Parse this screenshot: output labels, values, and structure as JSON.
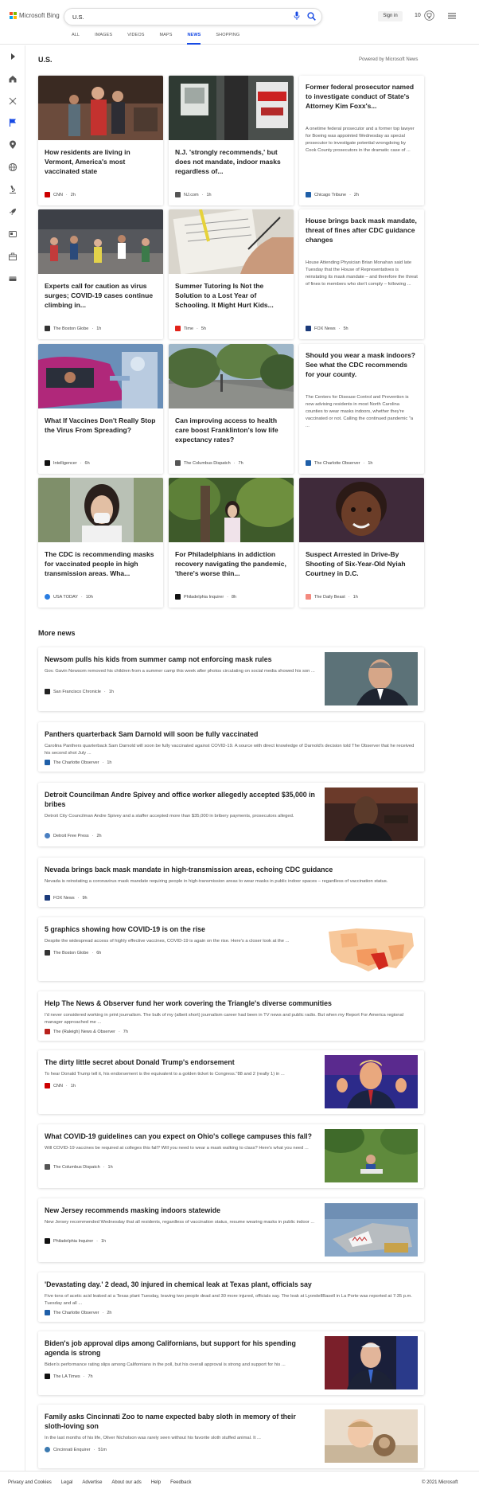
{
  "header": {
    "brand": "Microsoft Bing",
    "query": "U.S.",
    "signin_label": "Sign in",
    "rewards_count": "10",
    "tabs": [
      {
        "label": "ALL"
      },
      {
        "label": "IMAGES"
      },
      {
        "label": "VIDEOS"
      },
      {
        "label": "MAPS"
      },
      {
        "label": "NEWS"
      },
      {
        "label": "SHOPPING"
      }
    ],
    "active_tab": "NEWS"
  },
  "rail": {
    "icons": [
      "expand-icon",
      "home-icon",
      "sports-icon",
      "flag-icon",
      "location-icon",
      "globe-icon",
      "microscope-icon",
      "science-rocket-icon",
      "entertainment-icon",
      "business-icon",
      "money-icon"
    ]
  },
  "main": {
    "section_title": "U.S.",
    "powered_by": "Powered by Microsoft News",
    "cards": [
      {
        "title": "How residents are living in Vermont, America's most vaccinated state",
        "source": "CNN",
        "time": "2h"
      },
      {
        "title": "N.J. 'strongly recommends,' but does not mandate, indoor masks regardless of...",
        "source": "NJ.com",
        "time": "1h"
      },
      {
        "title": "Former federal prosecutor named to investigate conduct of State's Attorney Kim Foxx's...",
        "snippet": "A onetime federal prosecutor and a former top lawyer for Boeing was appointed Wednesday as special prosecutor to investigate potential wrongdoing by Cook County prosecutors in the dramatic case of ...",
        "source": "Chicago Tribune",
        "time": "2h"
      },
      {
        "title": "Experts call for caution as virus surges; COVID-19 cases continue climbing in...",
        "source": "The Boston Globe",
        "time": "1h"
      },
      {
        "title": "Summer Tutoring Is Not the Solution to a Lost Year of Schooling. It Might Hurt Kids...",
        "source": "Time",
        "time": "5h"
      },
      {
        "title": "House brings back mask mandate, threat of fines after CDC guidance changes",
        "snippet": "House Attending Physician Brian Monahan said late Tuesday that the House of Representatives is reinstating its mask mandate – and therefore the threat of fines to members who don't comply – following ...",
        "source": "FOX News",
        "time": "5h"
      },
      {
        "title": "What If Vaccines Don't Really Stop the Virus From Spreading?",
        "source": "Intelligencer",
        "time": "6h"
      },
      {
        "title": "Can improving access to health care boost Franklinton's low life expectancy rates?",
        "source": "The Columbus Dispatch",
        "time": "7h"
      },
      {
        "title": "Should you wear a mask indoors? See what the CDC recommends for your county.",
        "snippet": "The Centers for Disease Control and Prevention is now advising residents in most North Carolina counties to wear masks indoors, whether they're vaccinated or not. Calling the continued pandemic \"a ...",
        "source": "The Charlotte Observer",
        "time": "1h"
      },
      {
        "title": "The CDC is recommending masks for vaccinated people in high transmission areas. Wha...",
        "source": "USA TODAY",
        "time": "10h"
      },
      {
        "title": "For Philadelphians in addiction recovery navigating the pandemic, 'there's worse thin...",
        "source": "Philadelphia Inquirer",
        "time": "8h"
      },
      {
        "title": "Suspect Arrested in Drive-By Shooting of Six-Year-Old Nyiah Courtney in D.C.",
        "source": "The Daily Beast",
        "time": "1h"
      }
    ],
    "more_title": "More news",
    "more": [
      {
        "title": "Newsom pulls his kids from summer camp not enforcing mask rules",
        "snippet": "Gov. Gavin Newsom removed his children from a summer camp this week after photos circulating on social media showed his son ...",
        "source": "San Francisco Chronicle",
        "time": "1h"
      },
      {
        "title": "Panthers quarterback Sam Darnold will soon be fully vaccinated",
        "snippet": "Carolina Panthers quarterback Sam Darnold will soon be fully vaccinated against COVID-19. A source with direct knowledge of Darnold's decision told The Observer that he received his second shot July ...",
        "source": "The Charlotte Observer",
        "time": "1h"
      },
      {
        "title": "Detroit Councilman Andre Spivey and office worker allegedly accepted $35,000 in bribes",
        "snippet": "Detroit City Councilman Andre Spivey and a staffer accepted more than $35,000 in bribery payments, prosecutors alleged.",
        "source": "Detroit Free Press",
        "time": "2h"
      },
      {
        "title": "Nevada brings back mask mandate in high-transmission areas, echoing CDC guidance",
        "snippet": "Nevada is reinstating a coronavirus mask mandate requiring people in high-transmission areas to wear masks in public indoor spaces – regardless of vaccination status.",
        "source": "FOX News",
        "time": "9h"
      },
      {
        "title": "5 graphics showing how COVID-19 is on the rise",
        "snippet": "Despite the widespread access of highly effective vaccines, COVID-19 is again on the rise. Here's a closer look at the ...",
        "source": "The Boston Globe",
        "time": "6h"
      },
      {
        "title": "Help The News & Observer fund her work covering the Triangle's diverse communities",
        "snippet": "I'd never considered working in print journalism. The bulk of my (albeit short) journalism career had been in TV news and public radio. But when my Report For America regional manager approached me ...",
        "source": "The (Raleigh) News & Observer",
        "time": "7h"
      },
      {
        "title": "The dirty little secret about Donald Trump's endorsement",
        "snippet": "To hear Donald Trump tell it, his endorsement is the equivalent to a golden ticket to Congress.\"88 and 2 (really 1) in ...",
        "source": "CNN",
        "time": "1h"
      },
      {
        "title": "What COVID-19 guidelines can you expect on Ohio's college campuses this fall?",
        "snippet": "Will COVID-19 vaccines be required at colleges this fall? Will you need to wear a mask walking to class? Here's what you need ...",
        "source": "The Columbus Dispatch",
        "time": "1h"
      },
      {
        "title": "New Jersey recommends masking indoors statewide",
        "snippet": "New Jersey recommended Wednesday that all residents, regardless of vaccination status, resume wearing masks in public indoor ...",
        "source": "Philadelphia Inquirer",
        "time": "1h"
      },
      {
        "title": "'Devastating day.' 2 dead, 30 injured in chemical leak at Texas plant, officials say",
        "snippet": "Five tons of acetic acid leaked at a Texas plant Tuesday, leaving two people dead and 30 more injured, officials say. The leak at LyondellBasell in La Porte was reported at 7:35 p.m. Tuesday and all ...",
        "source": "The Charlotte Observer",
        "time": "2h"
      },
      {
        "title": "Biden's job approval dips among Californians, but support for his spending agenda is strong",
        "snippet": "Biden's performance rating slips among Californians in the poll, but his overall approval is strong and support for his ...",
        "source": "The LA Times",
        "time": "7h"
      },
      {
        "title": "Family asks Cincinnati Zoo to name expected baby sloth in memory of their sloth-loving son",
        "snippet": "In the last months of his life, Oliver Nicholson was rarely seen without his favorite sloth stuffed animal.   It ...",
        "source": "Cincinnati Enquirer",
        "time": "51m"
      }
    ]
  },
  "footer": {
    "links": [
      "Privacy and Cookies",
      "Legal",
      "Advertise",
      "About our ads",
      "Help",
      "Feedback"
    ],
    "copyright": "© 2021 Microsoft"
  },
  "colors": {
    "accent": "#174ae4",
    "bing_logo": [
      "#f25022",
      "#7fba00",
      "#00a4ef",
      "#ffb900"
    ]
  }
}
